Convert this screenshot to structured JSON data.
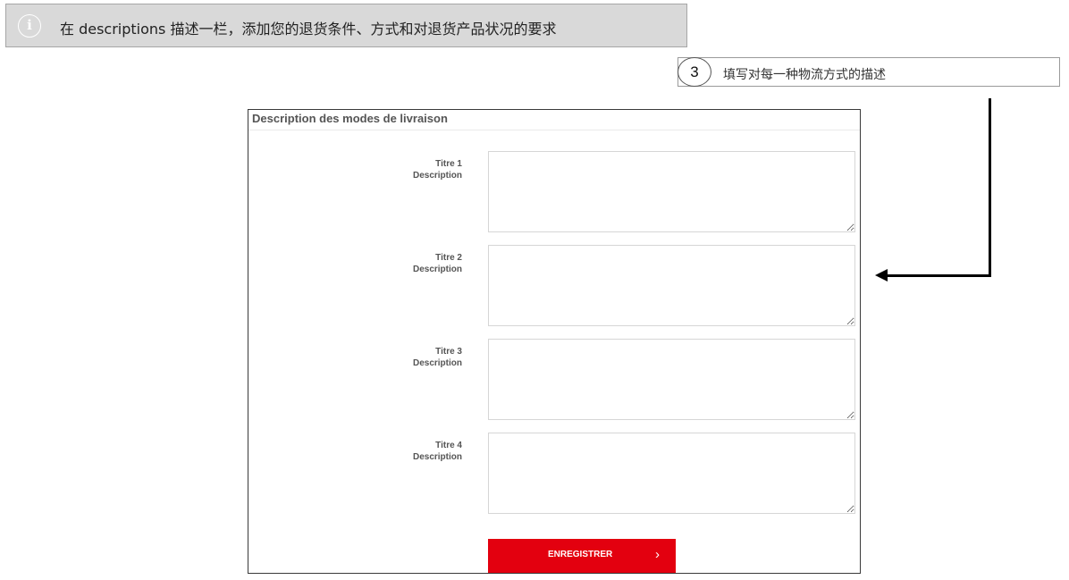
{
  "banner": {
    "icon": "info-icon",
    "icon_glyph": "i",
    "text": "在 descriptions 描述一栏，添加您的退货条件、方式和对退货产品状况的要求"
  },
  "step": {
    "number": "3",
    "text": "填写对每一种物流方式的描述"
  },
  "panel": {
    "title": "Description des modes de livraison",
    "rows": [
      {
        "title": "Titre 1",
        "description": "Description",
        "value": ""
      },
      {
        "title": "Titre 2",
        "description": "Description",
        "value": ""
      },
      {
        "title": "Titre 3",
        "description": "Description",
        "value": ""
      },
      {
        "title": "Titre 4",
        "description": "Description",
        "value": ""
      }
    ],
    "save_label": "ENREGISTRER",
    "save_icon": "chevron-right-icon",
    "save_glyph": "›"
  },
  "colors": {
    "banner_bg": "#d9d9d9",
    "button_red": "#e3000f"
  }
}
